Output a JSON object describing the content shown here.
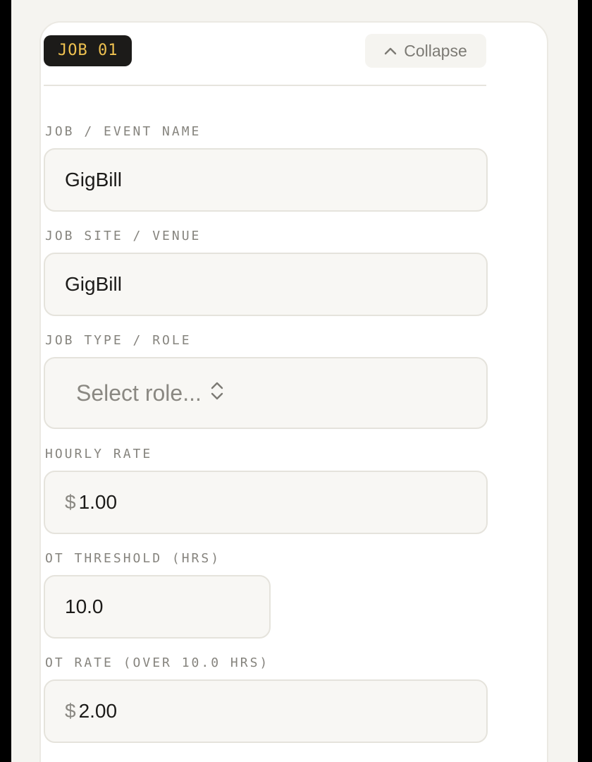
{
  "job": {
    "badge": "JOB 01",
    "collapse_label": "Collapse"
  },
  "fields": {
    "event_name": {
      "label": "JOB / EVENT NAME",
      "value": "GigBill"
    },
    "venue": {
      "label": "JOB SITE / VENUE",
      "value": "GigBill"
    },
    "role": {
      "label": "JOB TYPE / ROLE",
      "placeholder": "Select role..."
    },
    "hourly_rate": {
      "label": "HOURLY RATE",
      "currency": "$",
      "value": "1.00"
    },
    "ot_threshold": {
      "label": "OT THRESHOLD (HRS)",
      "value": "10.0"
    },
    "ot_rate": {
      "label": "OT RATE (OVER 10.0 HRS)",
      "currency": "$",
      "value": "2.00"
    }
  },
  "colors": {
    "badge_bg": "#1c1b19",
    "badge_text": "#f0c250",
    "page_bg": "#f5f4f0",
    "card_bg": "#ffffff"
  },
  "icons": {
    "collapse": "chevron-up-icon",
    "select": "chevron-up-down-icon"
  }
}
